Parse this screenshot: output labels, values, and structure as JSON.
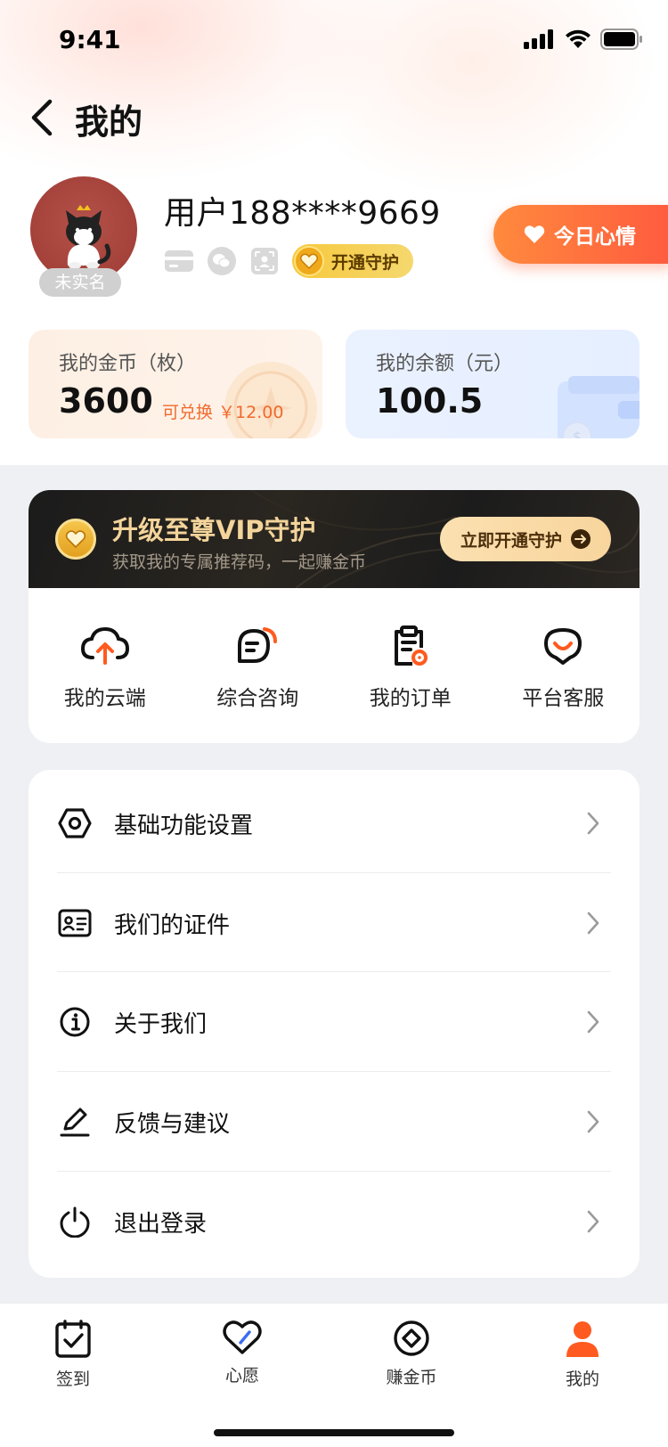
{
  "status_bar": {
    "time": "9:41"
  },
  "nav": {
    "title": "我的"
  },
  "profile": {
    "username": "用户188****9669",
    "real_name_badge": "未实名",
    "vip_pill": "开通守护",
    "mood_button": "今日心情"
  },
  "balances": {
    "coins_label": "我的金币（枚）",
    "coins_value": "3600",
    "coins_exchange": "可兑换 ￥12.00",
    "balance_label": "我的余额（元）",
    "balance_value": "100.5"
  },
  "vip_banner": {
    "title": "升级至尊VIP守护",
    "subtitle": "获取我的专属推荐码，一起赚金币",
    "button": "立即开通守护"
  },
  "quick_actions": [
    {
      "label": "我的云端",
      "icon": "cloud-upload-icon"
    },
    {
      "label": "综合咨询",
      "icon": "chat-bubble-icon"
    },
    {
      "label": "我的订单",
      "icon": "order-clipboard-icon"
    },
    {
      "label": "平台客服",
      "icon": "customer-service-icon"
    }
  ],
  "settings": [
    {
      "label": "基础功能设置",
      "icon": "settings-hexagon-icon"
    },
    {
      "label": "我们的证件",
      "icon": "id-card-icon"
    },
    {
      "label": "关于我们",
      "icon": "info-icon"
    },
    {
      "label": "反馈与建议",
      "icon": "edit-pen-icon"
    },
    {
      "label": "退出登录",
      "icon": "power-icon"
    }
  ],
  "tabbar": [
    {
      "label": "签到",
      "icon": "checkin-icon"
    },
    {
      "label": "心愿",
      "icon": "heart-wish-icon"
    },
    {
      "label": "赚金币",
      "icon": "coin-target-icon"
    },
    {
      "label": "我的",
      "icon": "user-icon",
      "active": true
    }
  ],
  "colors": {
    "accent": "#ff6a2c",
    "gold": "#f3d49a",
    "orange_text": "#f26a2c"
  }
}
